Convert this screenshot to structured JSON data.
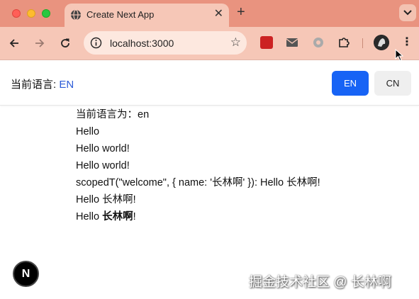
{
  "browser": {
    "tab_title": "Create Next App",
    "tab_close_glyph": "✕",
    "new_tab_glyph": "+",
    "url": "localhost:3000",
    "star_glyph": "☆",
    "menu_glyph": "⋮"
  },
  "header": {
    "label": "当前语言: ",
    "current_language": "EN",
    "buttons": {
      "en": "EN",
      "cn": "CN"
    }
  },
  "content": {
    "lines": [
      "当前语言为：en",
      "Hello",
      "Hello world!",
      "Hello world!",
      "scopedT(\"welcome\", { name: '长林啊' }): Hello 长林啊!",
      "Hello 长林啊!"
    ],
    "last_line_prefix": "Hello ",
    "last_line_bold": "长林啊",
    "last_line_suffix": "!"
  },
  "next_badge": "N",
  "watermark": "掘金技术社区 @ 长林啊",
  "colors": {
    "tabbar": "#e9937f",
    "toolbar": "#f6c7b7",
    "accent_blue": "#1763f5",
    "language_text": "#2b5bd7"
  }
}
